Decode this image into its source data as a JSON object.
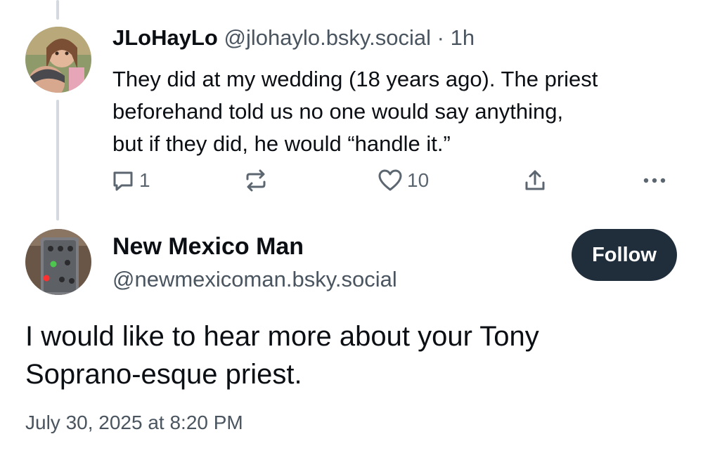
{
  "post1": {
    "display_name": "JLoHayLo",
    "handle": "@jlohaylo.bsky.social",
    "separator": "·",
    "time": "1h",
    "text_lines": [
      "They did at my wedding (18 years ago). The priest",
      "beforehand told us no one would say anything,",
      "but if they did, he would “handle it.”"
    ],
    "actions": {
      "reply_icon": "reply-icon",
      "reply_count": "1",
      "repost_icon": "repost-icon",
      "like_icon": "heart-icon",
      "like_count": "10",
      "share_icon": "share-icon",
      "more_icon": "more-icon"
    }
  },
  "post2": {
    "display_name": "New Mexico Man",
    "handle": "@newmexicoman.bsky.social",
    "follow_label": "Follow",
    "text_lines": [
      "I would like to hear more about your Tony",
      "Soprano-esque priest."
    ],
    "timestamp": "July 30, 2025 at 8:20 PM"
  },
  "colors": {
    "text": "#0b0f14",
    "muted": "#4a5560",
    "icon": "#5b6670",
    "thread_line": "#d4d9df",
    "follow_bg": "#202d3b"
  }
}
